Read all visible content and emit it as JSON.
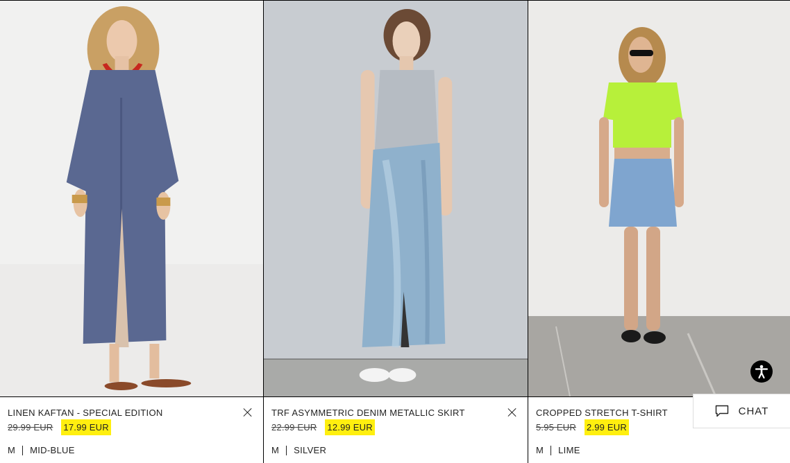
{
  "products": [
    {
      "name": "LINEN KAFTAN - SPECIAL EDITION",
      "old_price": "29.99 EUR",
      "new_price": "17.99 EUR",
      "size": "M",
      "color": "MID-BLUE",
      "removable": true
    },
    {
      "name": "TRF ASYMMETRIC DENIM METALLIC SKIRT",
      "old_price": "22.99 EUR",
      "new_price": "12.99 EUR",
      "size": "M",
      "color": "SILVER",
      "removable": true
    },
    {
      "name": "CROPPED STRETCH T-SHIRT",
      "old_price": "5.95 EUR",
      "new_price": "2.99 EUR",
      "size": "M",
      "color": "LIME",
      "removable": false
    }
  ],
  "chat": {
    "label": "CHAT",
    "icon": "chat-bubble-icon"
  },
  "accessibility": {
    "icon": "accessibility-icon"
  },
  "colors": {
    "price_highlight": "#ffef0f",
    "border": "#000000"
  }
}
